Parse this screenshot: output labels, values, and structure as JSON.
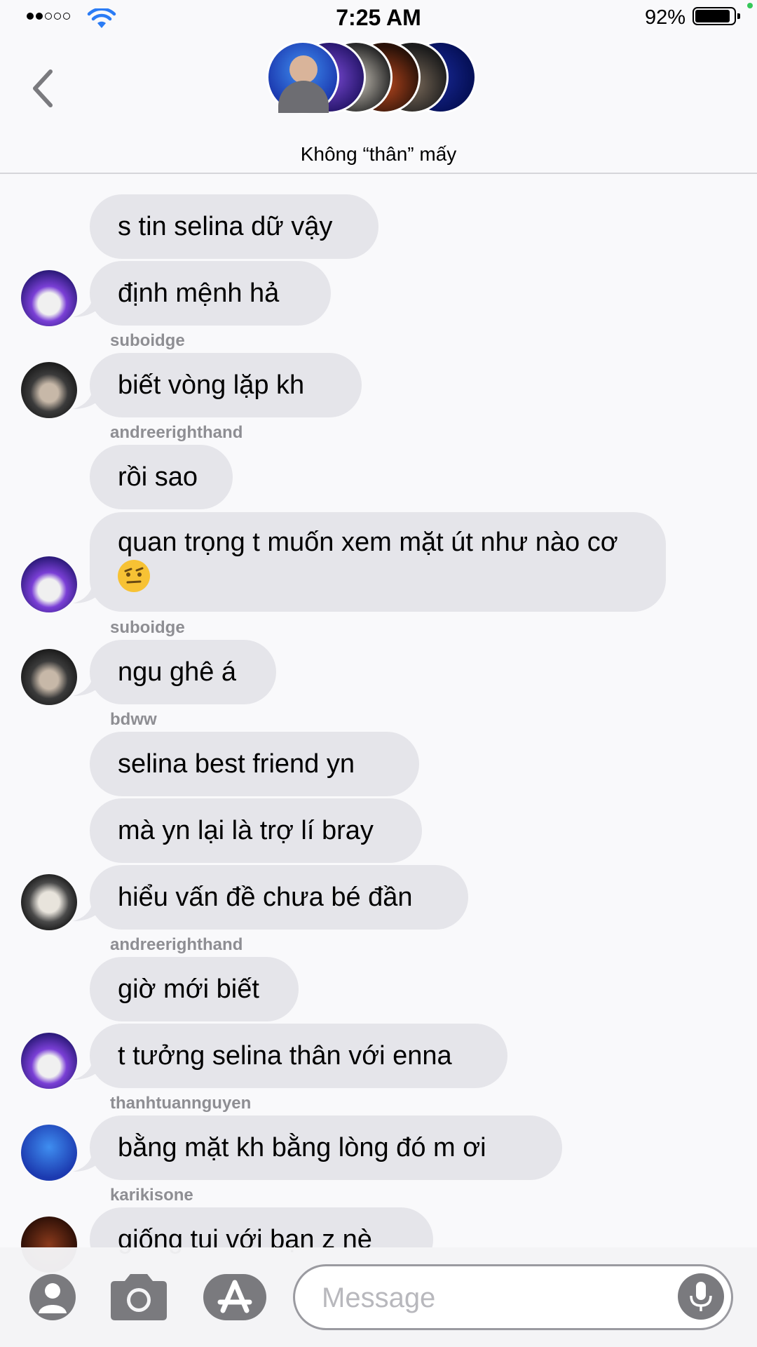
{
  "status_bar": {
    "time": "7:25 AM",
    "battery": "92%",
    "battery_level": 0.92
  },
  "header": {
    "title": "Không “thân” mấy"
  },
  "messages": [
    {
      "text": "s tin selina dữ vậy"
    },
    {
      "text": "định mệnh hả"
    },
    {
      "sender": "suboidge",
      "text": "biết vòng lặp kh"
    },
    {
      "sender": "andreerighthand",
      "text": "rồi sao"
    },
    {
      "text": "quan trọng t muốn xem mặt út như nào cơ"
    },
    {
      "sender": "suboidge",
      "text": "ngu ghê á"
    },
    {
      "sender": "bdww",
      "text": "selina best friend yn"
    },
    {
      "text": "mà yn lại là trợ lí bray"
    },
    {
      "text": "hiểu vấn đề chưa bé đần"
    },
    {
      "sender": "andreerighthand",
      "text": "giờ mới biết"
    },
    {
      "text": "t tưởng selina thân với enna"
    },
    {
      "sender": "thanhtuannguyen",
      "text": "bằng mặt kh bằng lòng đó m ơi"
    },
    {
      "sender": "karikisone",
      "text": "giống tui với bạn z nè"
    }
  ],
  "compose": {
    "placeholder": "Message"
  },
  "icons": [
    "back-chevron-icon",
    "info-icon",
    "contact-icon",
    "camera-icon",
    "app-store-icon",
    "microphone-icon"
  ],
  "colors": {
    "accent": "#2b7cf5",
    "bubble": "#e5e5ea",
    "secondary_text": "#8e8e93"
  }
}
